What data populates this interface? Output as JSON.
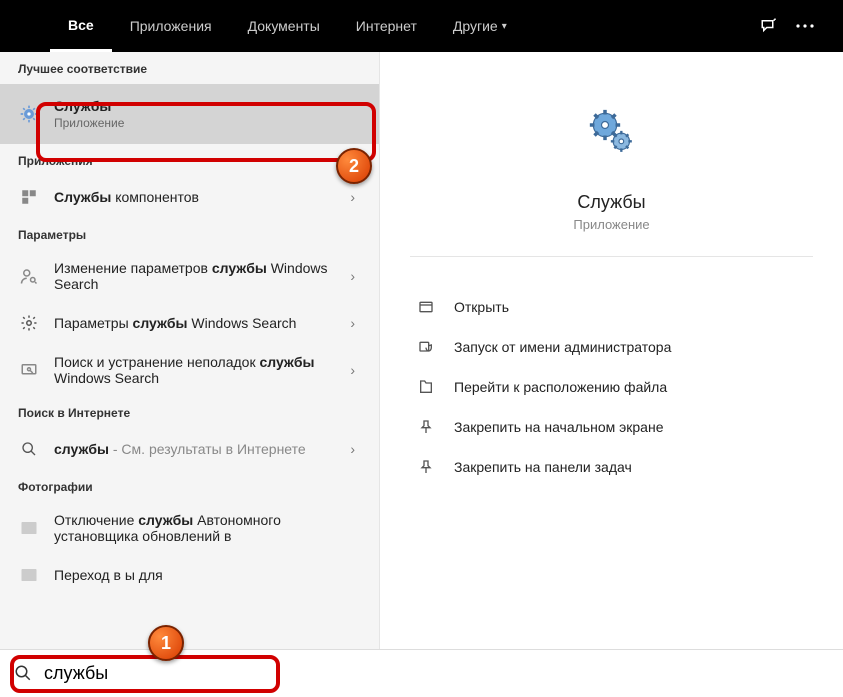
{
  "tabs": {
    "all": "Все",
    "apps": "Приложения",
    "docs": "Документы",
    "web": "Интернет",
    "more": "Другие"
  },
  "sections": {
    "best": "Лучшее соответствие",
    "apps": "Приложения",
    "settings": "Параметры",
    "web": "Поиск в Интернете",
    "photos": "Фотографии"
  },
  "best": {
    "title": "Службы",
    "type": "Приложение"
  },
  "apps_list": {
    "components_pre": "Службы",
    "components_post": " компонентов"
  },
  "settings_list": {
    "s1_pre": "Изменение параметров ",
    "s1_bold": "службы",
    "s1_post": " Windows Search",
    "s2_pre": "Параметры ",
    "s2_bold": "службы",
    "s2_post": " Windows Search",
    "s3_pre": "Поиск и устранение неполадок ",
    "s3_bold": "службы",
    "s3_post": " Windows Search"
  },
  "web_list": {
    "term": "службы",
    "hint": " - См. результаты в Интернете"
  },
  "photos_list": {
    "p1_pre": "Отключение ",
    "p1_bold": "службы",
    "p1_post": " Автономного установщика обновлений в",
    "p2_pre": "Переход в ",
    "p2_post": "ы для"
  },
  "preview": {
    "title": "Службы",
    "type": "Приложение"
  },
  "actions": {
    "open": "Открыть",
    "admin": "Запуск от имени администратора",
    "location": "Перейти к расположению файла",
    "start_pin": "Закрепить на начальном экране",
    "taskbar_pin": "Закрепить на панели задач"
  },
  "search": {
    "value": "службы"
  },
  "callouts": {
    "one": "1",
    "two": "2"
  }
}
